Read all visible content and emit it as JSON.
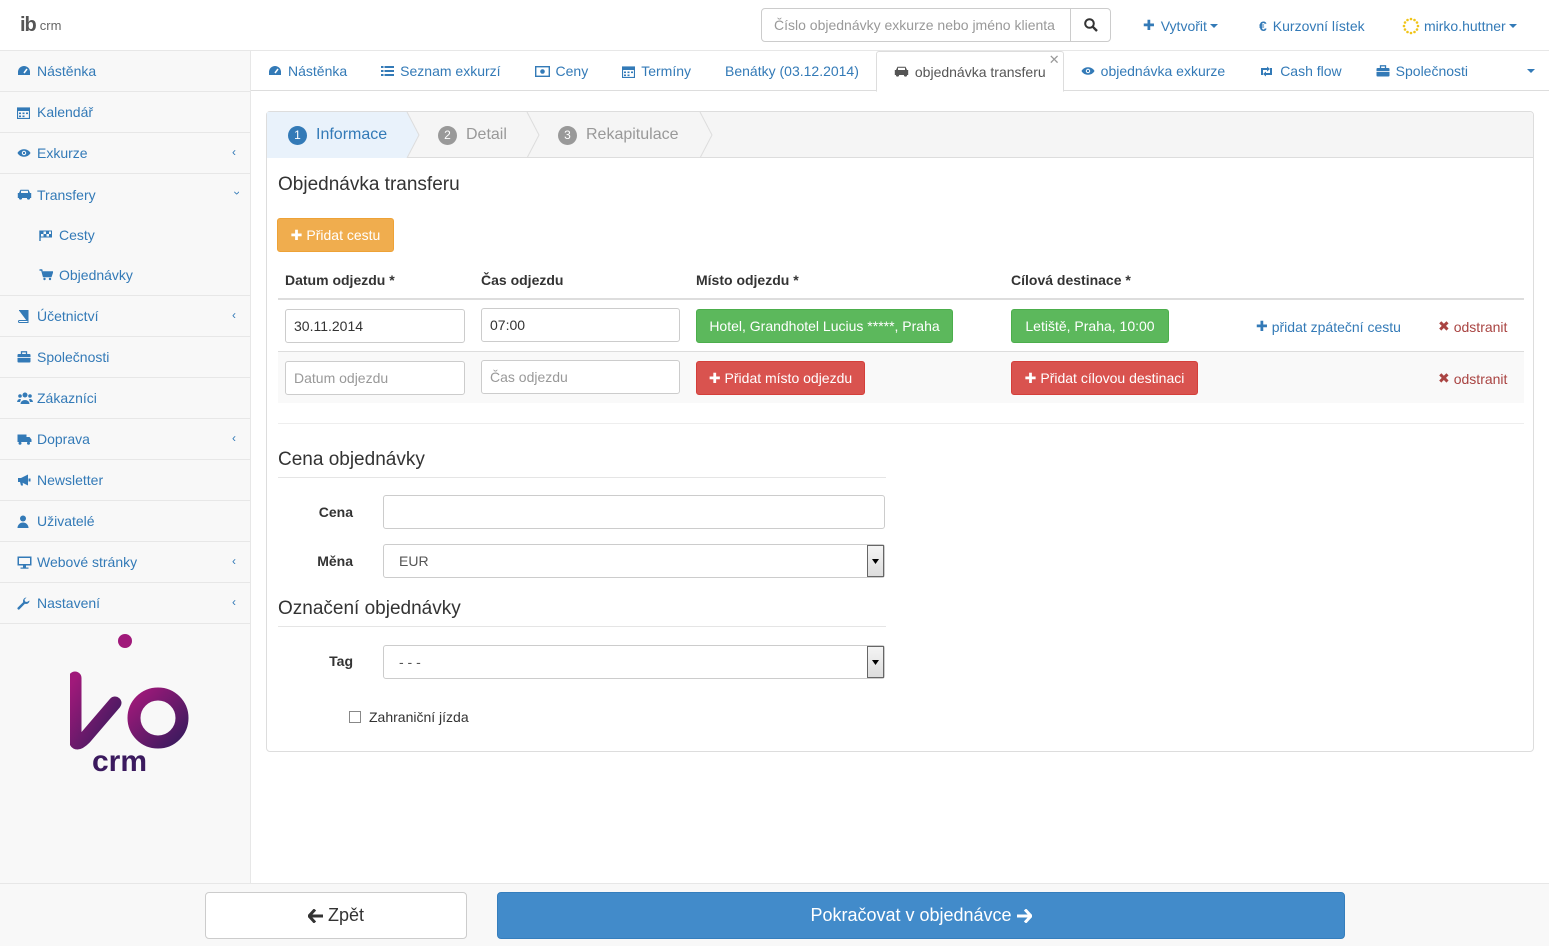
{
  "brand": {
    "logo_letters": "ib",
    "logo_suffix": "crm"
  },
  "search": {
    "placeholder": "Číslo objednávky exkurze nebo jméno klienta"
  },
  "topnav": {
    "create": "Vytvořit",
    "exchange": "Kurzovní lístek",
    "user": "mirko.huttner"
  },
  "sidebar": {
    "items": [
      {
        "label": "Nástěnka"
      },
      {
        "label": "Kalendář"
      },
      {
        "label": "Exkurze"
      },
      {
        "label": "Transfery"
      },
      {
        "label": "Účetnictví"
      },
      {
        "label": "Společnosti"
      },
      {
        "label": "Zákazníci"
      },
      {
        "label": "Doprava"
      },
      {
        "label": "Newsletter"
      },
      {
        "label": "Uživatelé"
      },
      {
        "label": "Webové stránky"
      },
      {
        "label": "Nastavení"
      }
    ],
    "sub": [
      {
        "label": "Cesty"
      },
      {
        "label": "Objednávky"
      }
    ]
  },
  "tabs": [
    {
      "label": "Nástěnka"
    },
    {
      "label": "Seznam exkurzí"
    },
    {
      "label": "Ceny"
    },
    {
      "label": "Termíny"
    },
    {
      "label": "Benátky (03.12.2014)"
    },
    {
      "label": "objednávka transferu"
    },
    {
      "label": "objednávka exkurze"
    },
    {
      "label": "Cash flow"
    },
    {
      "label": "Společnosti"
    }
  ],
  "wizard": {
    "steps": [
      {
        "num": "1",
        "label": "Informace"
      },
      {
        "num": "2",
        "label": "Detail"
      },
      {
        "num": "3",
        "label": "Rekapitulace"
      }
    ]
  },
  "order": {
    "title": "Objednávka transferu",
    "add_route": "Přidat cestu",
    "headers": {
      "date": "Datum odjezdu *",
      "time": "Čas odjezdu",
      "from": "Místo odjezdu *",
      "to": "Cílová destinace *"
    },
    "row1": {
      "date": "30.11.2014",
      "time": "07:00",
      "from": "Hotel, Grandhotel Lucius *****, Praha",
      "to": "Letiště, Praha, 10:00",
      "return": "přidat zpáteční cestu",
      "remove": "odstranit"
    },
    "row2": {
      "date_ph": "Datum odjezdu",
      "time_ph": "Čas odjezdu",
      "from": "Přidat místo odjezdu",
      "to": "Přidat cílovou destinaci",
      "remove": "odstranit"
    }
  },
  "price": {
    "title": "Cena objednávky",
    "price_label": "Cena",
    "price_value": "",
    "currency_label": "Měna",
    "currency_value": "EUR"
  },
  "marking": {
    "title": "Označení objednávky",
    "tag_label": "Tag",
    "tag_value": "- - -",
    "foreign_label": "Zahraniční jízda"
  },
  "footer": {
    "back": "Zpět",
    "continue": "Pokračovat v objednávce"
  },
  "colors": {
    "primary": "#337ab7",
    "success": "#5cb85c",
    "danger": "#d9534f",
    "warning": "#f0ad4e",
    "brand_gradient": [
      "#8b1a6b",
      "#3b1a5e"
    ]
  }
}
